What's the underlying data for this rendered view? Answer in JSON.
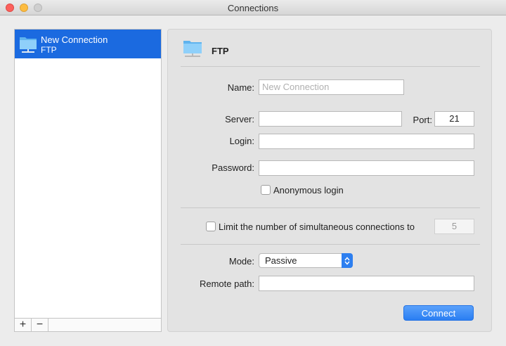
{
  "window": {
    "title": "Connections"
  },
  "sidebar": {
    "items": [
      {
        "name": "New Connection",
        "type": "FTP",
        "icon": "folder-icon"
      }
    ],
    "add_label": "+",
    "remove_label": "−"
  },
  "panel": {
    "header": "FTP",
    "header_icon": "network-folder-icon",
    "name_label": "Name:",
    "name_placeholder": "New Connection",
    "server_label": "Server:",
    "server_value": "",
    "port_label": "Port:",
    "port_value": "21",
    "login_label": "Login:",
    "login_value": "",
    "password_label": "Password:",
    "password_value": "",
    "anonymous_label": "Anonymous login",
    "anonymous_checked": false,
    "limit_label": "Limit the number of simultaneous connections to",
    "limit_checked": false,
    "limit_value": "5",
    "mode_label": "Mode:",
    "mode_value": "Passive",
    "remote_path_label": "Remote path:",
    "remote_path_value": "",
    "connect_label": "Connect"
  },
  "colors": {
    "accent": "#2a7ef2",
    "selection": "#1b6ae0"
  }
}
